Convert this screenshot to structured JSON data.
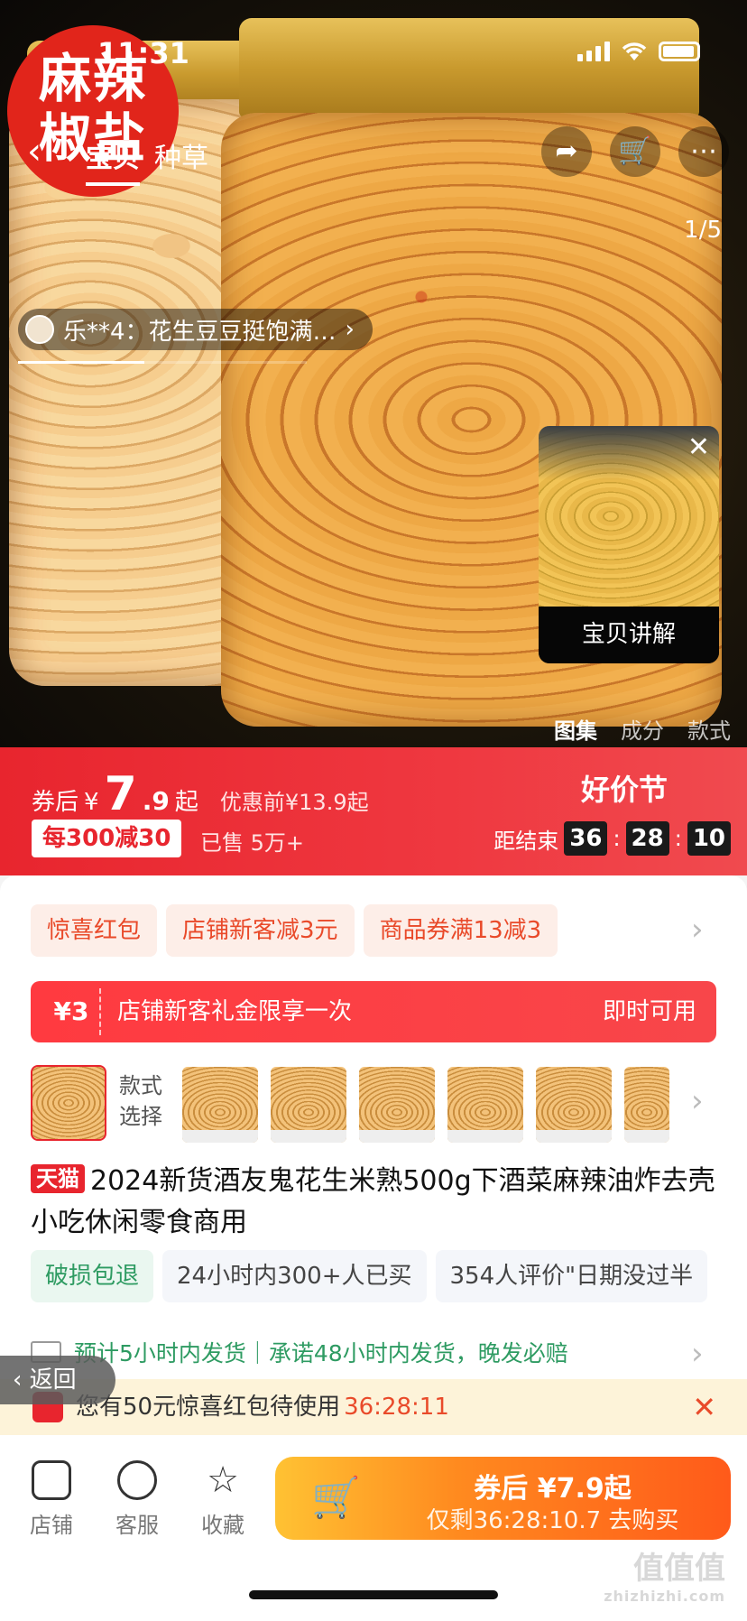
{
  "status_bar": {
    "time": "11:31"
  },
  "hero": {
    "logo_text": "麻辣\n椒盐",
    "nav_tabs": [
      "宝贝",
      "种草"
    ],
    "page_counter": "1/5",
    "review": "乐**4：花生豆豆挺饱满…",
    "video_label": "宝贝讲解",
    "bottom_tabs": [
      "图集",
      "成分",
      "款式"
    ]
  },
  "price": {
    "prefix": "券后",
    "currency": "¥",
    "integer": "7",
    "decimal": ".9",
    "suffix": "起",
    "original": "优惠前¥13.9起",
    "deal_tag": "每300减30",
    "sold": "已售 5万+",
    "festival": "好价节",
    "countdown_label": "距结束",
    "countdown": [
      "36",
      "28",
      "10"
    ]
  },
  "coupons": [
    "惊喜红包",
    "店铺新客减3元",
    "商品券满13减3"
  ],
  "gift": {
    "amount": "¥3",
    "text": "店铺新客礼金限享一次",
    "action": "即时可用"
  },
  "variants": {
    "label": "款式\n选择",
    "count": 6
  },
  "product": {
    "badge": "天猫",
    "title": "2024新货酒友鬼花生米熟500g下酒菜麻辣油炸去壳小吃休闲零食商用"
  },
  "tags": [
    "破损包退",
    "24小时内300+人已买",
    "354人评价\"日期没过半"
  ],
  "shipping": "预计5小时内发货｜承诺48小时内发货，晚发必赔",
  "back_button": "返回",
  "notice": {
    "text": "您有50元惊喜红包待使用",
    "time": "36:28:11"
  },
  "bottom_nav": {
    "shop": "店铺",
    "service": "客服",
    "favorite": "收藏"
  },
  "buy": {
    "main": "券后 ¥7.9起",
    "sub": "仅剩36:28:10.7 去购买"
  },
  "watermark": {
    "logo": "值值值",
    "url": "zhizhizhi.com"
  }
}
